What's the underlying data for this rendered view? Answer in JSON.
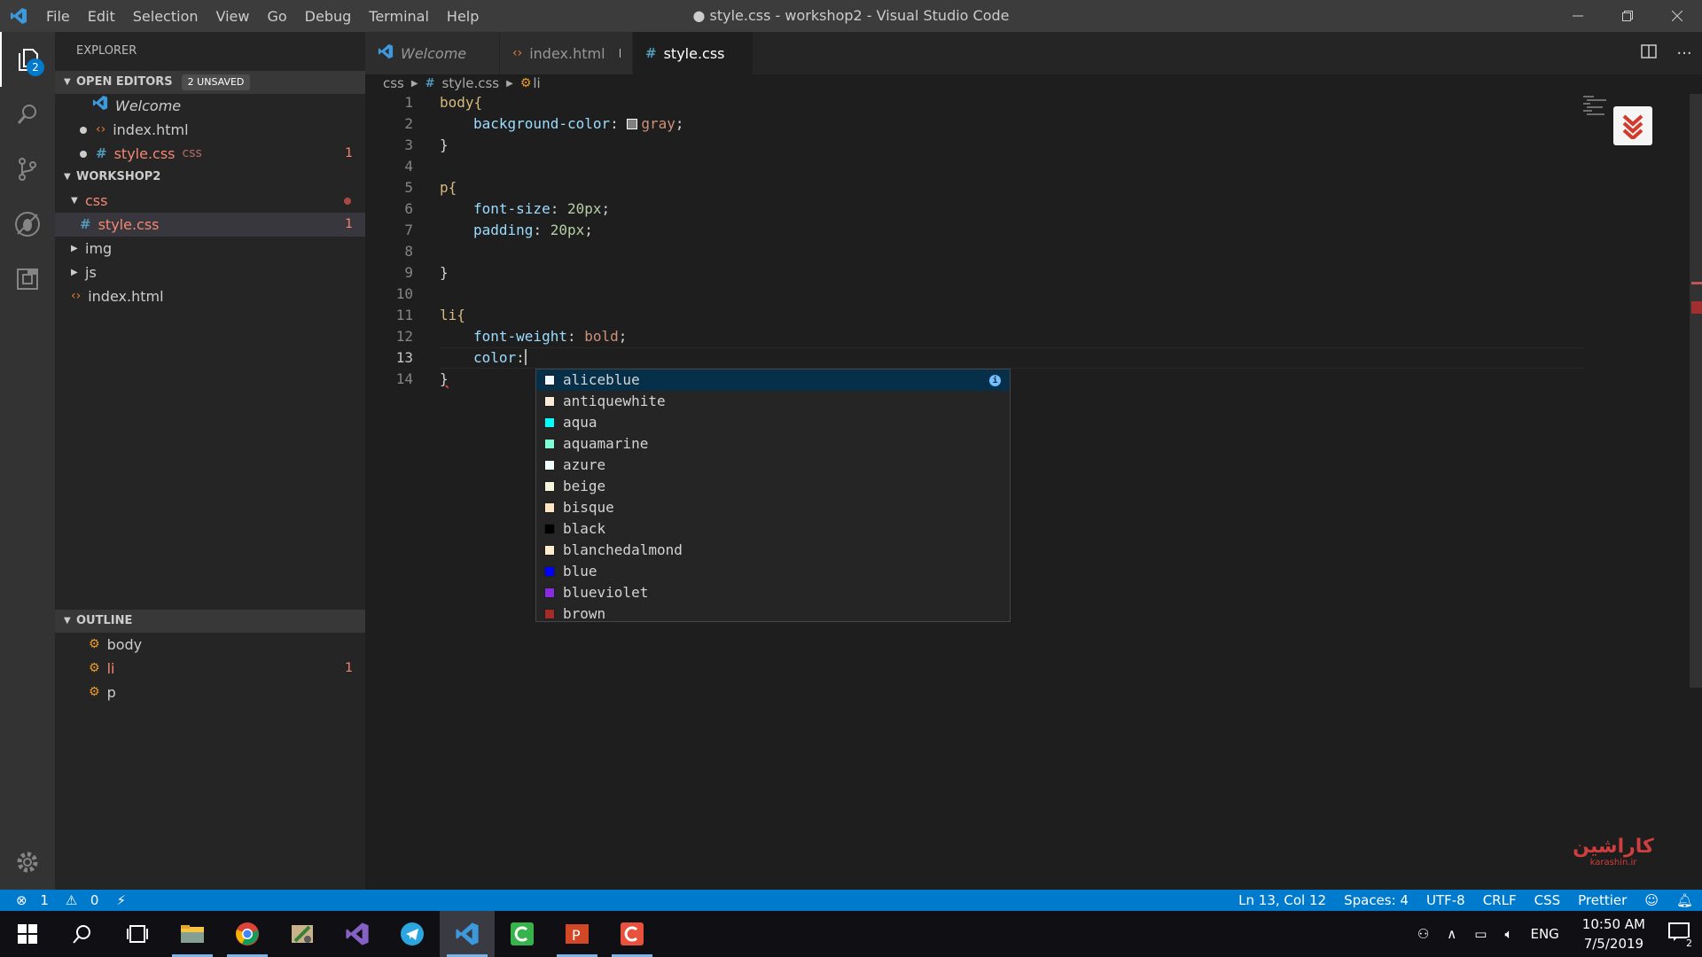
{
  "titlebar": {
    "menu": [
      "File",
      "Edit",
      "Selection",
      "View",
      "Go",
      "Debug",
      "Terminal",
      "Help"
    ],
    "title": "● style.css - workshop2 - Visual Studio Code"
  },
  "activitybar": {
    "explorer_badge": "2"
  },
  "sidebar": {
    "title": "EXPLORER",
    "open_editors": {
      "header": "OPEN EDITORS",
      "badge": "2 UNSAVED",
      "items": [
        {
          "label": "Welcome"
        },
        {
          "label": "index.html"
        },
        {
          "label": "style.css",
          "lang": "css",
          "problems": "1"
        }
      ]
    },
    "workspace": {
      "header": "WORKSHOP2",
      "items": [
        {
          "label": "css"
        },
        {
          "label": "style.css",
          "problems": "1"
        },
        {
          "label": "img"
        },
        {
          "label": "js"
        },
        {
          "label": "index.html"
        }
      ]
    },
    "outline": {
      "header": "OUTLINE",
      "items": [
        {
          "label": "body"
        },
        {
          "label": "li",
          "problems": "1"
        },
        {
          "label": "p"
        }
      ]
    }
  },
  "tabs": [
    {
      "label": "Welcome"
    },
    {
      "label": "index.html"
    },
    {
      "label": "style.css"
    }
  ],
  "breadcrumb": {
    "folder": "css",
    "file": "style.css",
    "symbol": "li"
  },
  "editor": {
    "line_numbers": [
      "1",
      "2",
      "3",
      "4",
      "5",
      "6",
      "7",
      "8",
      "9",
      "10",
      "11",
      "12",
      "13",
      "14"
    ],
    "code": {
      "l1_sel": "body{",
      "l2_prop": "background-color",
      "l2_colon": ": ",
      "l2_val": "gray",
      "l2_end": ";",
      "l3": "}",
      "l5_sel": "p{",
      "l6_prop": "font-size",
      "l6_colon": ": ",
      "l6_val": "20px",
      "l6_end": ";",
      "l7_prop": "padding",
      "l7_colon": ": ",
      "l7_val": "20px",
      "l7_end": ";",
      "l9": "}",
      "l11_sel": "li{",
      "l12_prop": "font-weight",
      "l12_colon": ": ",
      "l12_val": "bold",
      "l12_end": ";",
      "l13_prop": "color",
      "l13_colon": ":",
      "l14": "}"
    },
    "gray_swatch_color": "#808080"
  },
  "suggestions": [
    {
      "label": "aliceblue",
      "color": "#f0f8ff"
    },
    {
      "label": "antiquewhite",
      "color": "#faebd7"
    },
    {
      "label": "aqua",
      "color": "#00ffff"
    },
    {
      "label": "aquamarine",
      "color": "#7fffd4"
    },
    {
      "label": "azure",
      "color": "#f0ffff"
    },
    {
      "label": "beige",
      "color": "#f5f5dc"
    },
    {
      "label": "bisque",
      "color": "#ffe4c4"
    },
    {
      "label": "black",
      "color": "#000000"
    },
    {
      "label": "blanchedalmond",
      "color": "#ffebcd"
    },
    {
      "label": "blue",
      "color": "#0000ff"
    },
    {
      "label": "blueviolet",
      "color": "#8a2be2"
    },
    {
      "label": "brown",
      "color": "#a52a2a"
    }
  ],
  "watermark": {
    "text": "کاراشین",
    "sub": "karashin.ir"
  },
  "statusbar": {
    "errors": "1",
    "warnings": "0",
    "position": "Ln 13, Col 12",
    "spaces": "Spaces: 4",
    "encoding": "UTF-8",
    "eol": "CRLF",
    "language": "CSS",
    "formatter": "Prettier"
  },
  "taskbar": {
    "lang": "ENG",
    "time": "10:50 AM",
    "date": "7/5/2019",
    "notifications": "2"
  },
  "colors": {
    "accent": "#007acc",
    "error": "#f48771",
    "selector": "#d7ba7d",
    "property": "#9cdcfe",
    "number": "#b5cea8",
    "value": "#ce9178"
  }
}
